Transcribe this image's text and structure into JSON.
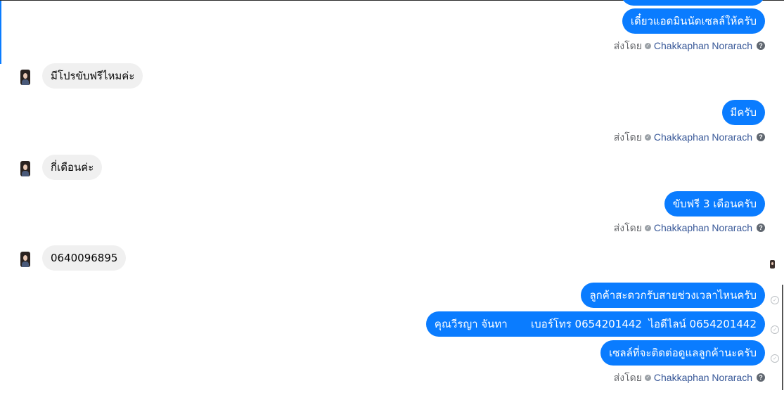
{
  "conversation": {
    "messages": [
      {
        "direction": "out",
        "text": "เดี๋ยวแอดมินนัดเซลล์ให้ครับ"
      },
      {
        "direction": "in",
        "text": "มีโปรขับฟรีไหมค่ะ"
      },
      {
        "direction": "out",
        "text": "มีครับ"
      },
      {
        "direction": "in",
        "text": "กี่เดือนค่ะ"
      },
      {
        "direction": "out",
        "text": "ขับฟรี 3 เดือนครับ"
      },
      {
        "direction": "in",
        "text": "0640096895"
      },
      {
        "direction": "out",
        "text": "ลูกค้าสะดวกรับสายช่วงเวลาไหนครับ"
      },
      {
        "direction": "out",
        "text": "คุณวีรญา จันทา       เบอร์โทร 0654201442  ไอดีไลน์ 0654201442"
      },
      {
        "direction": "out",
        "text": "เซลล์ที่จะติดต่อดูแลลูกค้านะครับ"
      }
    ],
    "sent_by_label": "ส่งโดย",
    "sender_name": "Chakkaphan Norarach",
    "help_icon": "?",
    "status_icon": "✓"
  },
  "colors": {
    "outgoing_bubble": "#0a7cff",
    "incoming_bubble": "#f0f0f0",
    "sender_name": "#385898",
    "meta_text": "#65676b"
  }
}
